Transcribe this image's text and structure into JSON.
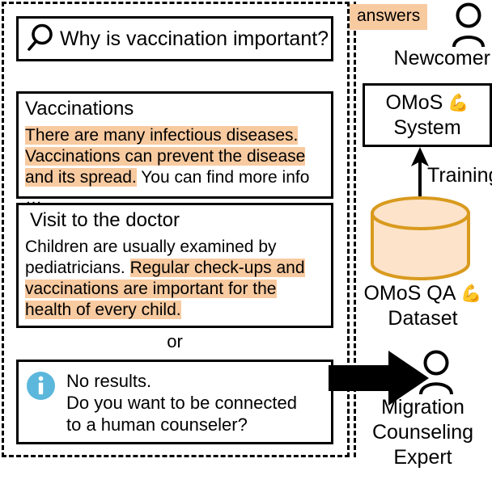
{
  "search": {
    "icon": "search-icon",
    "query": "Why is vaccination important?"
  },
  "results": [
    {
      "title": "Vaccinations",
      "body_highlighted": "There are many infectious diseases. Vaccinations can prevent the disease and its spread.",
      "body_plain": " You can find more info …"
    },
    {
      "title": "Visit to the doctor",
      "body_plain_prefix": "Children are usually examined by pediatricians. ",
      "body_highlighted": "Regular check-ups and vaccinations are important for the health of every child."
    }
  ],
  "or_label": "or",
  "no_results": {
    "icon": "info-icon",
    "line1": "No results.",
    "line2": "Do you want to be connected",
    "line3": "to a human counseler?"
  },
  "right": {
    "answers_chip": "answers",
    "newcomer_icon": "person-icon",
    "newcomer_label": "Newcomer",
    "system_line1": "OMoS",
    "system_line2": "System",
    "system_emoji": "💪",
    "training_label": "Training",
    "training_arrow_icon": "arrow-up-icon",
    "dataset_line1": "OMoS QA",
    "dataset_line2": "Dataset",
    "dataset_emoji": "💪",
    "dataset_icon": "database-cylinder-icon",
    "escalation_arrow_icon": "arrow-right-icon",
    "expert_icon": "person-icon",
    "expert_line1": "Migration",
    "expert_line2": "Counseling",
    "expert_line3": "Expert"
  },
  "colors": {
    "highlight": "#f8caa0",
    "info_blue": "#5bb7db",
    "cylinder_stroke": "#d99a1e",
    "cylinder_fill": "#fce3ca",
    "outline": "#000000"
  }
}
